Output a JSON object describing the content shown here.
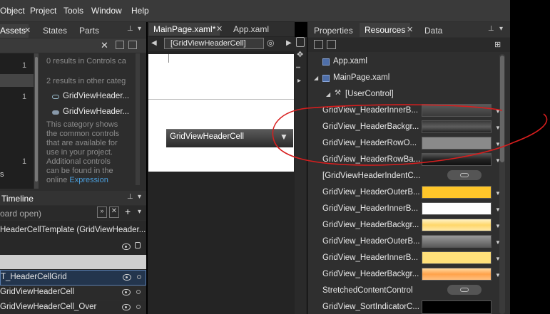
{
  "menubar": {
    "items": [
      "Object",
      "Project",
      "Tools",
      "Window",
      "Help"
    ]
  },
  "left_panel": {
    "tabs": [
      "Assets",
      "States",
      "Parts"
    ],
    "results_controls": "0 results in Controls ca",
    "results_other": "2 results in other categ",
    "counts": [
      "1",
      "1",
      "1"
    ],
    "items": [
      "GridViewHeader...",
      "GridViewHeader..."
    ],
    "description": [
      "This category shows",
      "the common controls",
      "that are available for",
      "use in your project.",
      "Additional controls",
      "can be found in the",
      "online"
    ],
    "link": "Expression",
    "side_letter": "s"
  },
  "timeline": {
    "title": "Timeline",
    "search_placeholder": "oard open)",
    "template_title": "HeaderCellTemplate (GridViewHeader...",
    "rows": [
      "T_HeaderCellGrid",
      "GridViewHeaderCell",
      "GridViewHeaderCell_Over"
    ]
  },
  "center": {
    "tabs": [
      "MainPage.xaml*",
      "App.xaml"
    ],
    "breadcrumb": "[GridViewHeaderCell]",
    "cell_label": "GridViewHeaderCell"
  },
  "right_panel": {
    "tabs": [
      "Properties",
      "Resources",
      "Data"
    ],
    "tree": [
      "App.xaml",
      "MainPage.xaml",
      "[UserControl]"
    ],
    "resources": [
      {
        "name": "GridView_HeaderInnerB...",
        "color": "#4a4a4a"
      },
      {
        "name": "GridView_HeaderBackgr...",
        "color": "#3a3a3a"
      },
      {
        "name": "GridView_HeaderRowO...",
        "color": "#8a8a8a"
      },
      {
        "name": "GridView_HeaderRowBa...",
        "color": "#2a2a2a"
      },
      {
        "name": "[GridViewHeaderIndentC...",
        "color": ""
      },
      {
        "name": "GridView_HeaderOuterB...",
        "color": "#ffc62a"
      },
      {
        "name": "GridView_HeaderInnerB...",
        "color": "#ffffff"
      },
      {
        "name": "GridView_HeaderBackgr...",
        "color": "#ffe08a"
      },
      {
        "name": "GridView_HeaderOuterB...",
        "color": "#7a7a7a"
      },
      {
        "name": "GridView_HeaderInnerB...",
        "color": "#ffe07a"
      },
      {
        "name": "GridView_HeaderBackgr...",
        "color": "#ffb060"
      },
      {
        "name": "StretchedContentControl",
        "color": ""
      },
      {
        "name": "GridView_SortIndicatorC...",
        "color": "#000000"
      }
    ]
  },
  "colors": {
    "accent_link": "#4a9edc",
    "annotation": "#d81e1e"
  }
}
